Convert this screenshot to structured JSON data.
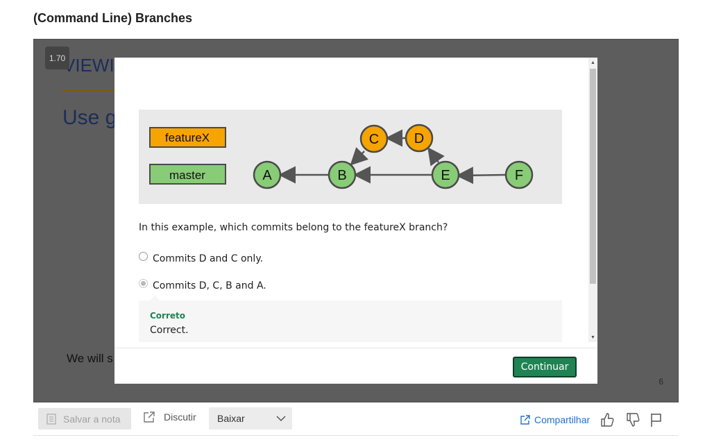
{
  "page": {
    "title": "(Command Line) Branches"
  },
  "player": {
    "speed": "1.70",
    "slide_number": "6",
    "slide_heading": "VIEWIN",
    "slide_use": "Use g",
    "slide_bottom": "We will s"
  },
  "quiz": {
    "diagram": {
      "branches": [
        "featureX",
        "master"
      ],
      "commits": [
        "A",
        "B",
        "C",
        "D",
        "E",
        "F"
      ],
      "colors": {
        "feature_fill": "#f6a400",
        "master_fill": "#88cc77",
        "commit_feature_fill": "#f6a400",
        "commit_master_fill": "#88cc77",
        "arrow": "#555555",
        "background": "#e9e9e9"
      }
    },
    "question": "In this example, which commits belong to the featureX branch?",
    "options": [
      {
        "label": "Commits D and C only.",
        "selected": false
      },
      {
        "label": "Commits D, C, B and A.",
        "selected": true
      }
    ],
    "feedback": {
      "title": "Correto",
      "text": "Correct.",
      "color": "#1f8354"
    },
    "continue_label": "Continuar"
  },
  "toolbar": {
    "save_note_label": "Salvar a nota",
    "discuss_label": "Discutir",
    "download_label": "Baixar",
    "share_label": "Compartilhar",
    "icons": [
      "note-icon",
      "external-link-icon",
      "chevron-down-icon",
      "share-icon",
      "thumbs-up-icon",
      "thumbs-down-icon",
      "flag-icon"
    ]
  }
}
